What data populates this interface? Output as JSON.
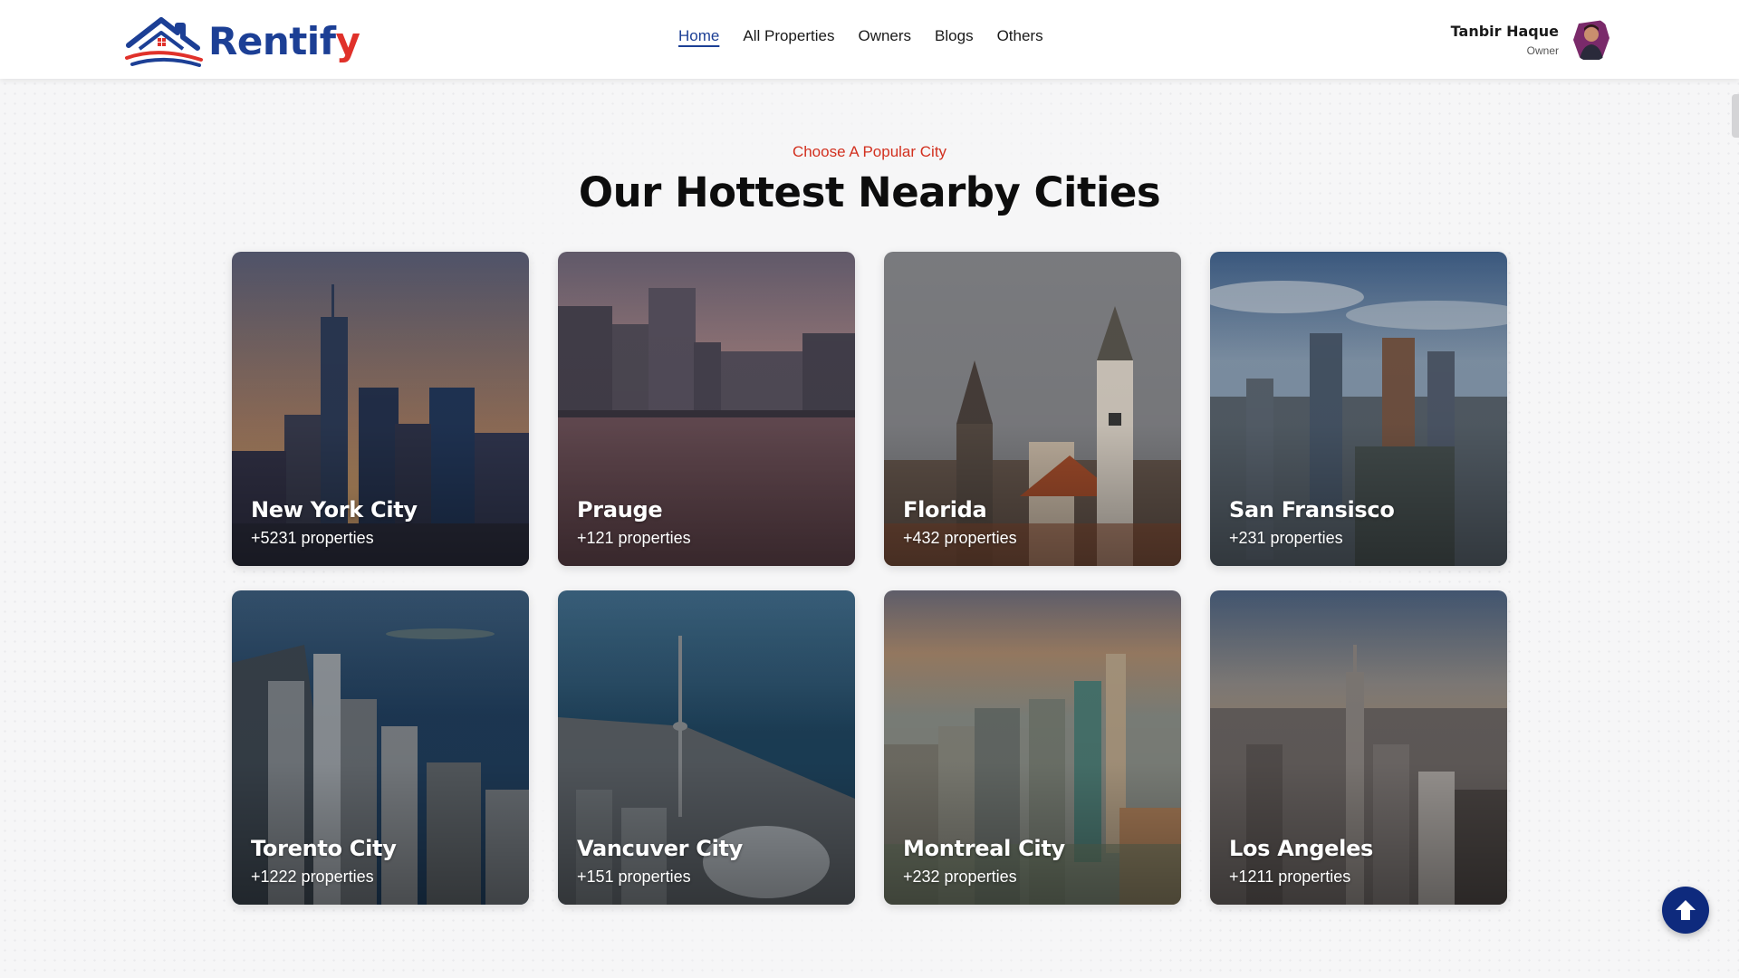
{
  "brand": {
    "part1": "Rentif",
    "part2": "y",
    "primary_color": "#1c3f95",
    "accent_color": "#e0312a",
    "icon": "house-roof-logo-icon"
  },
  "nav": {
    "items": [
      "Home",
      "All Properties",
      "Owners",
      "Blogs",
      "Others"
    ],
    "active": "Home"
  },
  "user": {
    "name": "Tanbir Haque",
    "role": "Owner",
    "icon": "user-avatar"
  },
  "section": {
    "eyebrow": "Choose A Popular City",
    "title": "Our Hottest Nearby Cities"
  },
  "cities": [
    {
      "name": "New York City",
      "count": "+5231 properties"
    },
    {
      "name": "Prauge",
      "count": "+121 properties"
    },
    {
      "name": "Florida",
      "count": "+432 properties"
    },
    {
      "name": "San Fransisco",
      "count": "+231 properties"
    },
    {
      "name": "Torento City",
      "count": "+1222 properties"
    },
    {
      "name": "Vancuver City",
      "count": "+151 properties"
    },
    {
      "name": "Montreal City",
      "count": "+232 properties"
    },
    {
      "name": "Los Angeles",
      "count": "+1211 properties"
    }
  ],
  "scroll_top": {
    "icon": "arrow-up-icon",
    "color": "#0e2a7d"
  }
}
